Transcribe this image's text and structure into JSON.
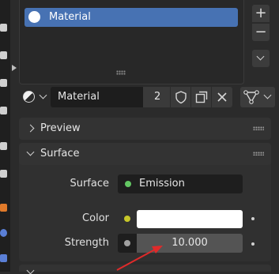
{
  "slots": {
    "items": [
      {
        "label": "Material",
        "swatch_color": "#ffffff",
        "selected": true
      }
    ],
    "add_label": "+",
    "remove_label": "−"
  },
  "material_selector": {
    "name": "Material",
    "user_count": "2"
  },
  "panels": {
    "preview": {
      "label": "Preview",
      "expanded": false
    },
    "surface": {
      "label": "Surface",
      "expanded": true,
      "properties": {
        "surface": {
          "label": "Surface",
          "value": "Emission",
          "socket_color": "#63c763"
        },
        "color": {
          "label": "Color",
          "value_color": "#ffffff",
          "socket_color": "#c7c729"
        },
        "strength": {
          "label": "Strength",
          "value": "10.000",
          "socket_color": "#a1a1a1"
        }
      }
    }
  },
  "colors": {
    "accent_selected": "#4772b3",
    "annotation_arrow": "#e02a2a"
  }
}
